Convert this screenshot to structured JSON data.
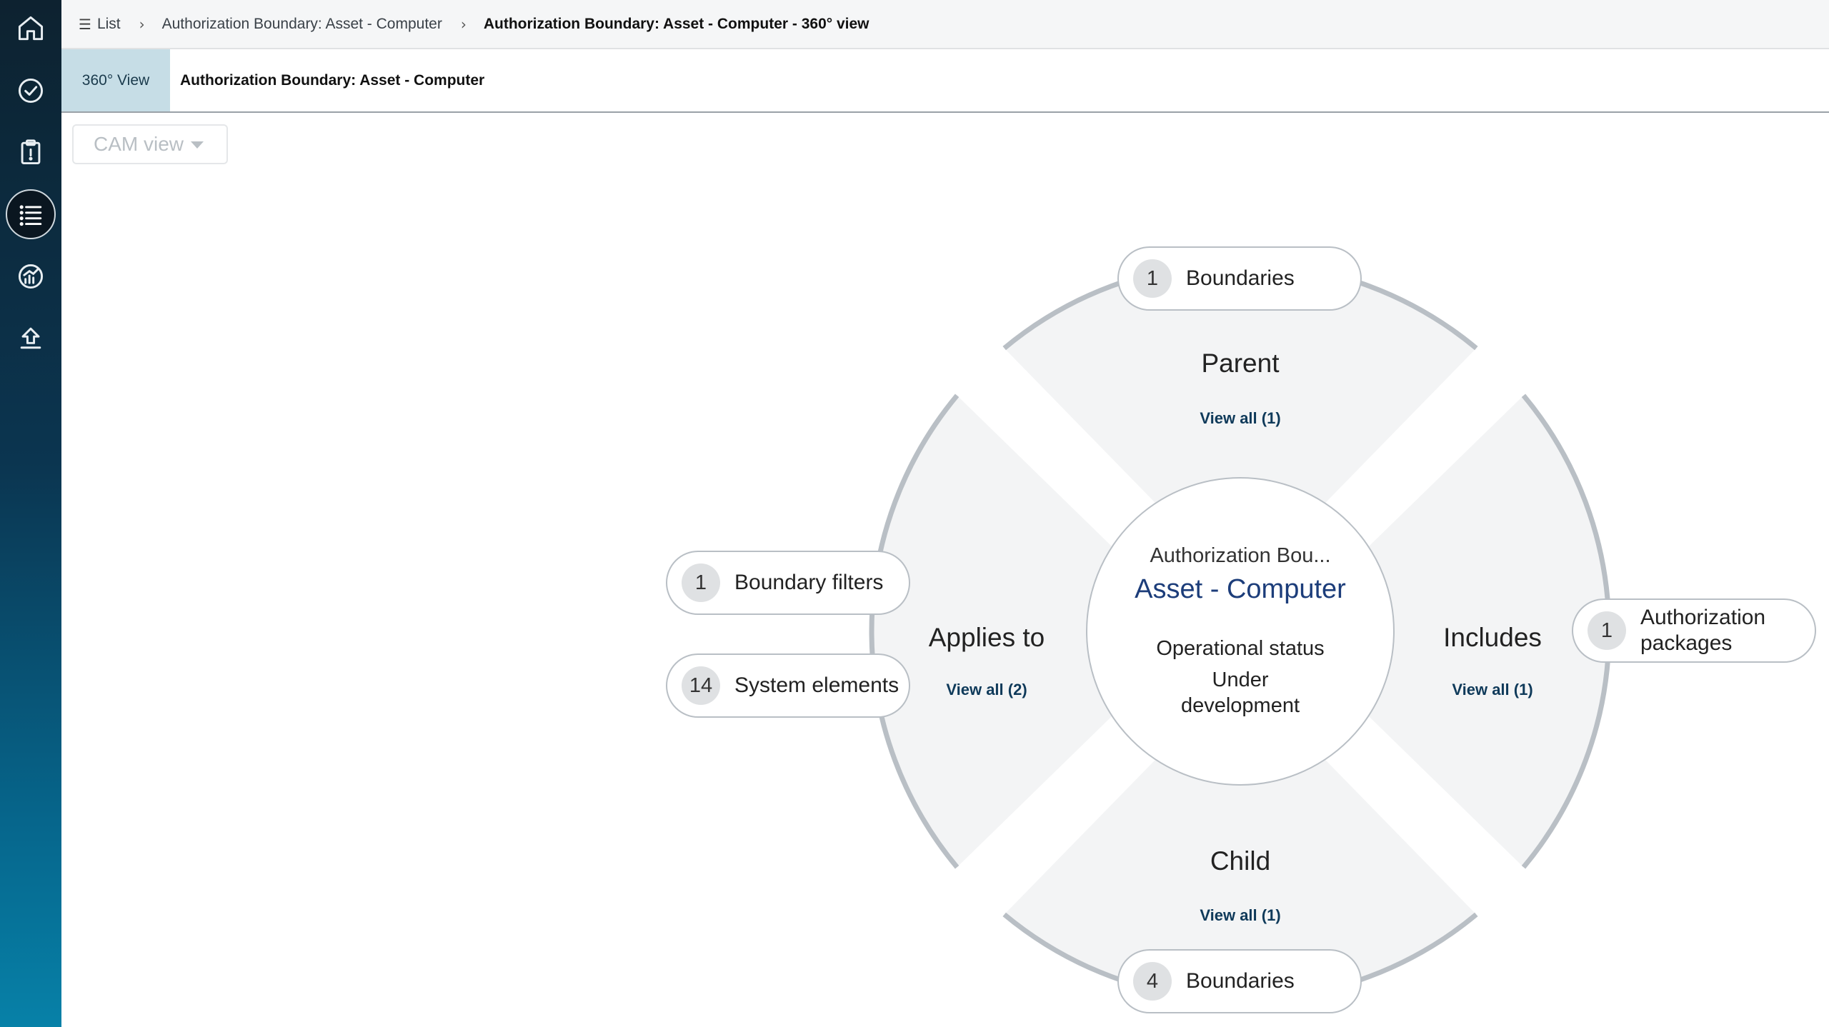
{
  "rail": {
    "items": [
      {
        "icon": "home-icon"
      },
      {
        "icon": "check-circle-icon"
      },
      {
        "icon": "clipboard-alert-icon"
      },
      {
        "icon": "list-icon",
        "active": true
      },
      {
        "icon": "dashboard-gauge-icon"
      },
      {
        "icon": "upload-icon"
      }
    ]
  },
  "breadcrumb": {
    "items": [
      "List",
      "Authorization Boundary: Asset - Computer",
      "Authorization Boundary: Asset - Computer - 360° view"
    ]
  },
  "tabs": {
    "active_label": "360° View",
    "title": "Authorization Boundary: Asset - Computer"
  },
  "cam_view": {
    "label": "CAM view"
  },
  "diagram": {
    "center": {
      "type": "Authorization Bou...",
      "name": "Asset - Computer",
      "status_label": "Operational status",
      "status_value": "Under development"
    },
    "segments": {
      "parent": {
        "label": "Parent",
        "view_all": "View all (1)"
      },
      "applies_to": {
        "label": "Applies to",
        "view_all": "View all (2)"
      },
      "includes": {
        "label": "Includes",
        "view_all": "View all (1)"
      },
      "child": {
        "label": "Child",
        "view_all": "View all (1)"
      }
    },
    "pills": {
      "parent_boundaries": {
        "count": "1",
        "label": "Boundaries"
      },
      "boundary_filters": {
        "count": "1",
        "label": "Boundary filters"
      },
      "system_elements": {
        "count": "14",
        "label": "System elements"
      },
      "authorization_packages": {
        "count": "1",
        "label": "Authorization packages"
      },
      "child_boundaries": {
        "count": "4",
        "label": "Boundaries"
      }
    }
  },
  "colors": {
    "rail_top": "#0d2230",
    "rail_bottom": "#0781a8",
    "segment_fill": "#f3f4f5",
    "ring_stroke": "#b9bfc5",
    "link": "#0f3a5a",
    "center_name": "#1c3d7a",
    "active_tab": "#c6dde6"
  }
}
